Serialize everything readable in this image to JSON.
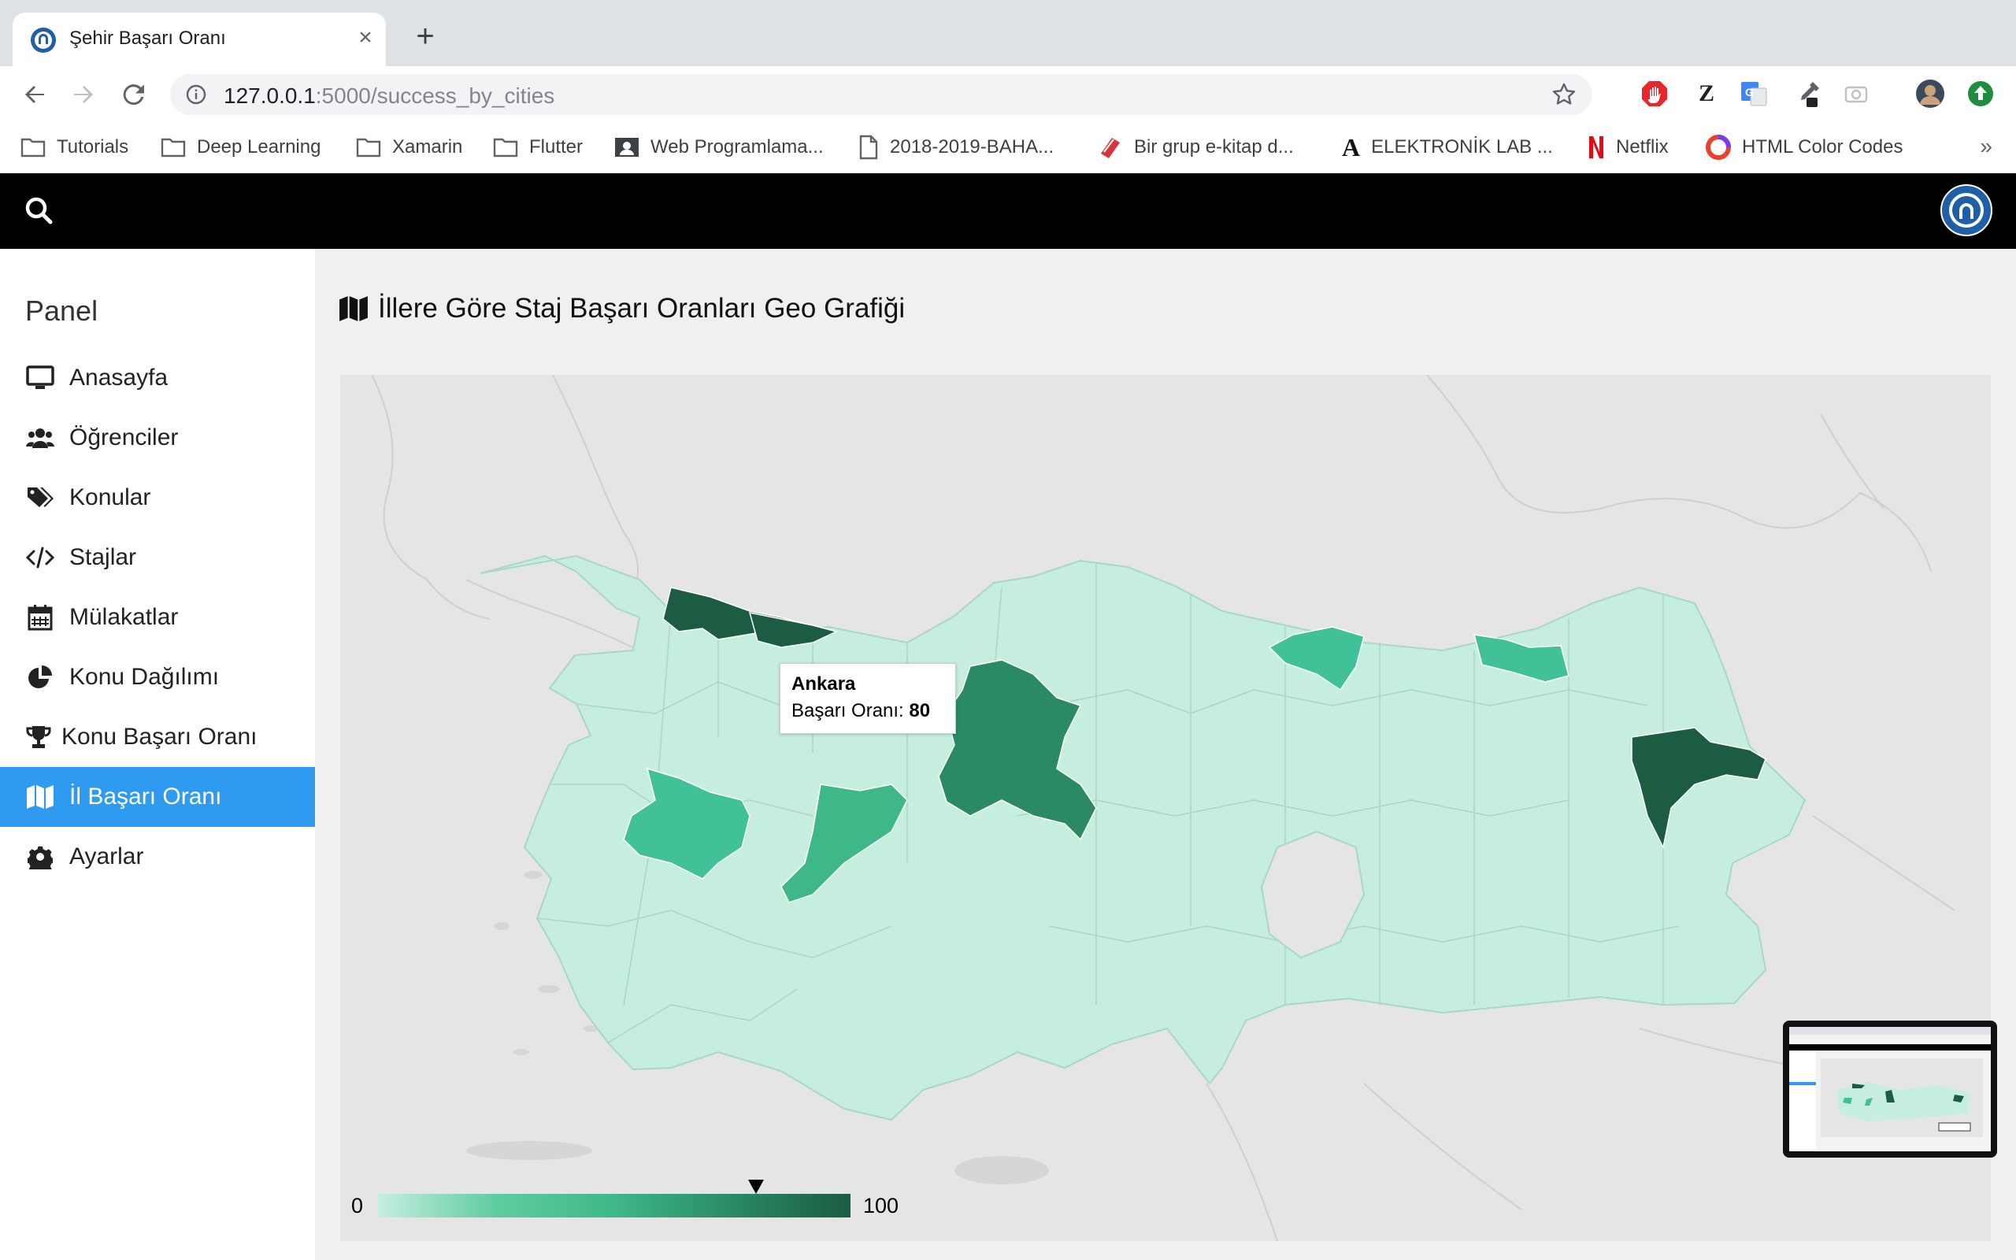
{
  "browser": {
    "tab_title": "Şehir Başarı Oranı",
    "url_host": "127.0.0.1",
    "url_rest": ":5000/success_by_cities",
    "bookmarks": [
      {
        "label": "Tutorials",
        "icon": "folder-icon"
      },
      {
        "label": "Deep Learning",
        "icon": "folder-icon"
      },
      {
        "label": "Xamarin",
        "icon": "folder-icon"
      },
      {
        "label": "Flutter",
        "icon": "folder-icon"
      },
      {
        "label": "Web Programlama...",
        "icon": "classroom-icon"
      },
      {
        "label": "2018-2019-BAHA...",
        "icon": "document-icon"
      },
      {
        "label": "Bir grup e-kitap d...",
        "icon": "ebook-icon"
      },
      {
        "label": "ELEKTRONİK LAB ...",
        "icon": "letter-a-icon"
      },
      {
        "label": "Netflix",
        "icon": "netflix-icon"
      },
      {
        "label": "HTML Color Codes",
        "icon": "color-wheel-icon"
      }
    ],
    "ext_z_label": "Z"
  },
  "sidebar": {
    "title": "Panel",
    "items": [
      {
        "label": "Anasayfa",
        "icon": "desktop-icon"
      },
      {
        "label": "Öğrenciler",
        "icon": "users-icon"
      },
      {
        "label": "Konular",
        "icon": "tags-icon"
      },
      {
        "label": "Stajlar",
        "icon": "code-icon"
      },
      {
        "label": "Mülakatlar",
        "icon": "calendar-icon"
      },
      {
        "label": "Konu Dağılımı",
        "icon": "pie-chart-icon"
      },
      {
        "label": "Konu Başarı Oranı",
        "icon": "trophy-icon"
      },
      {
        "label": "İl Başarı Oranı",
        "icon": "map-icon",
        "active": true
      },
      {
        "label": "Ayarlar",
        "icon": "cog-icon"
      }
    ]
  },
  "main": {
    "title": "İllere Göre Staj Başarı Oranları Geo Grafiği"
  },
  "tooltip": {
    "city": "Ankara",
    "label": "Başarı Oranı: ",
    "value": "80"
  },
  "legend": {
    "min": "0",
    "max": "100",
    "marker_value": 80
  },
  "chart_data": {
    "type": "geo",
    "region": "Turkey (provinces)",
    "color_axis": {
      "min": 0,
      "max": 100,
      "colors": [
        "#c6eedf",
        "#1b5c42"
      ]
    },
    "highlighted": [
      {
        "city": "Ankara",
        "value": 80
      }
    ]
  },
  "colors": {
    "accent": "#2e9bf0",
    "topbar": "#000000",
    "map_base": "#c6eedf"
  }
}
